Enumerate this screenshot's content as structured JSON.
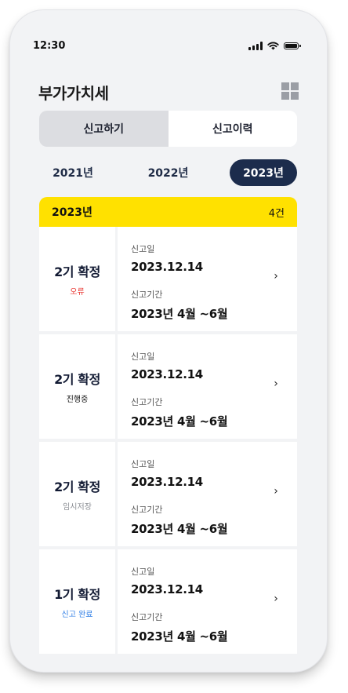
{
  "status_bar": {
    "time": "12:30"
  },
  "header": {
    "title": "부가가치세"
  },
  "tabs": [
    {
      "label": "신고하기",
      "active": true
    },
    {
      "label": "신고이력",
      "active": false
    }
  ],
  "years": [
    {
      "label": "2021년",
      "selected": false
    },
    {
      "label": "2022년",
      "selected": false
    },
    {
      "label": "2023년",
      "selected": true
    }
  ],
  "year_header": {
    "label": "2023년",
    "count": "4건"
  },
  "colors": {
    "accent_yellow": "#ffe100",
    "navy": "#1c2c4c",
    "status_error": "#e8312c",
    "status_progress": "#111111",
    "status_temp": "#8a8d93",
    "status_done": "#2f7ee6"
  },
  "records": [
    {
      "period": "2기 확정",
      "status": "오류",
      "status_color": "#e8312c",
      "date_label": "신고일",
      "date": "2023.12.14",
      "range_label": "신고기간",
      "range": "2023년 4월 ~6월"
    },
    {
      "period": "2기 확정",
      "status": "진행중",
      "status_color": "#111111",
      "date_label": "신고일",
      "date": "2023.12.14",
      "range_label": "신고기간",
      "range": "2023년 4월 ~6월"
    },
    {
      "period": "2기 확정",
      "status": "임시저장",
      "status_color": "#8a8d93",
      "date_label": "신고일",
      "date": "2023.12.14",
      "range_label": "신고기간",
      "range": "2023년 4월 ~6월"
    },
    {
      "period": "1기 확정",
      "status": "신고 완료",
      "status_color": "#2f7ee6",
      "date_label": "신고일",
      "date": "2023.12.14",
      "range_label": "신고기간",
      "range": "2023년 4월 ~6월"
    }
  ],
  "icons": {
    "menu": "grid-icon",
    "row": "chevron-right-icon"
  }
}
